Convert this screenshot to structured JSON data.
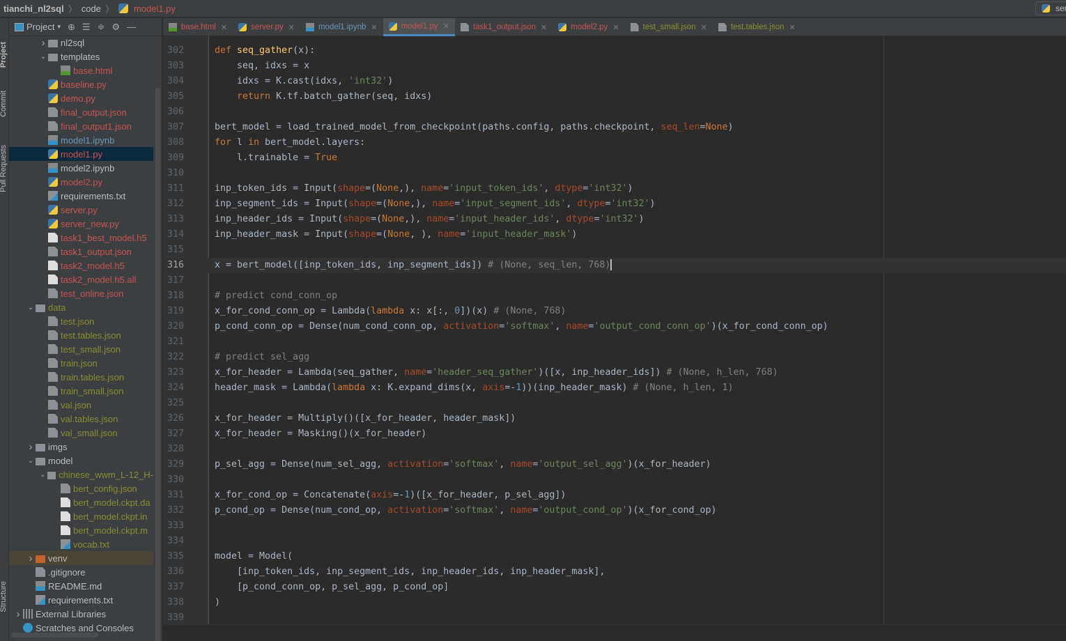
{
  "breadcrumb": [
    "tianchi_nl2sql",
    "code",
    "model1.py"
  ],
  "run_config": "ser",
  "tool_strip": [
    "Project",
    "Commit",
    "Pull Requests",
    "Structure"
  ],
  "project_panel": {
    "title": "Project"
  },
  "colors": {
    "untracked": "#c75450",
    "modified": "#6897bb",
    "ignored": "#8c8c2e",
    "normal": "#bbbbbb",
    "accent": "#4a88c7"
  },
  "tree": [
    {
      "label": "nl2sql",
      "depth": 2,
      "arrow": "right",
      "icon": "folder",
      "color": "normal"
    },
    {
      "label": "templates",
      "depth": 2,
      "arrow": "down",
      "icon": "folder",
      "color": "normal"
    },
    {
      "label": "base.html",
      "depth": 3,
      "icon": "html",
      "color": "untracked"
    },
    {
      "label": "baseline.py",
      "depth": 2,
      "icon": "py",
      "color": "untracked"
    },
    {
      "label": "demo.py",
      "depth": 2,
      "icon": "py",
      "color": "untracked"
    },
    {
      "label": "final_output.json",
      "depth": 2,
      "icon": "json",
      "color": "untracked"
    },
    {
      "label": "final_output1.json",
      "depth": 2,
      "icon": "json",
      "color": "untracked"
    },
    {
      "label": "model1.ipynb",
      "depth": 2,
      "icon": "ipynb",
      "color": "modified"
    },
    {
      "label": "model1.py",
      "depth": 2,
      "icon": "py",
      "color": "untracked",
      "selected": true
    },
    {
      "label": "model2.ipynb",
      "depth": 2,
      "icon": "ipynb",
      "color": "normal"
    },
    {
      "label": "model2.py",
      "depth": 2,
      "icon": "py",
      "color": "untracked"
    },
    {
      "label": "requirements.txt",
      "depth": 2,
      "icon": "txt",
      "color": "normal"
    },
    {
      "label": "server.py",
      "depth": 2,
      "icon": "py",
      "color": "untracked"
    },
    {
      "label": "server_new.py",
      "depth": 2,
      "icon": "py",
      "color": "untracked"
    },
    {
      "label": "task1_best_model.h5",
      "depth": 2,
      "icon": "file",
      "color": "untracked"
    },
    {
      "label": "task1_output.json",
      "depth": 2,
      "icon": "json",
      "color": "untracked"
    },
    {
      "label": "task2_model.h5",
      "depth": 2,
      "icon": "file",
      "color": "untracked"
    },
    {
      "label": "task2_model.h5.all",
      "depth": 2,
      "icon": "file",
      "color": "untracked"
    },
    {
      "label": "test_online.json",
      "depth": 2,
      "icon": "json",
      "color": "untracked"
    },
    {
      "label": "data",
      "depth": 1,
      "arrow": "down",
      "icon": "folder",
      "color": "ignored"
    },
    {
      "label": "test.json",
      "depth": 2,
      "icon": "json",
      "color": "ignored"
    },
    {
      "label": "test.tables.json",
      "depth": 2,
      "icon": "json",
      "color": "ignored"
    },
    {
      "label": "test_small.json",
      "depth": 2,
      "icon": "json",
      "color": "ignored"
    },
    {
      "label": "train.json",
      "depth": 2,
      "icon": "json",
      "color": "ignored"
    },
    {
      "label": "train.tables.json",
      "depth": 2,
      "icon": "json",
      "color": "ignored"
    },
    {
      "label": "train_small.json",
      "depth": 2,
      "icon": "json",
      "color": "ignored"
    },
    {
      "label": "val.json",
      "depth": 2,
      "icon": "json",
      "color": "ignored"
    },
    {
      "label": "val.tables.json",
      "depth": 2,
      "icon": "json",
      "color": "ignored"
    },
    {
      "label": "val_small.json",
      "depth": 2,
      "icon": "json",
      "color": "ignored"
    },
    {
      "label": "imgs",
      "depth": 1,
      "arrow": "right",
      "icon": "folder",
      "color": "normal"
    },
    {
      "label": "model",
      "depth": 1,
      "arrow": "down",
      "icon": "folder",
      "color": "normal"
    },
    {
      "label": "chinese_wwm_L-12_H-",
      "depth": 2,
      "arrow": "down",
      "icon": "folder",
      "color": "ignored"
    },
    {
      "label": "bert_config.json",
      "depth": 3,
      "icon": "json",
      "color": "ignored"
    },
    {
      "label": "bert_model.ckpt.da",
      "depth": 3,
      "icon": "file",
      "color": "ignored"
    },
    {
      "label": "bert_model.ckpt.in",
      "depth": 3,
      "icon": "file",
      "color": "ignored"
    },
    {
      "label": "bert_model.ckpt.m",
      "depth": 3,
      "icon": "file",
      "color": "ignored"
    },
    {
      "label": "vocab.txt",
      "depth": 3,
      "icon": "txt",
      "color": "ignored"
    },
    {
      "label": "venv",
      "depth": 1,
      "arrow": "right",
      "icon": "folder-orange",
      "color": "normal",
      "venv": true
    },
    {
      "label": ".gitignore",
      "depth": 1,
      "icon": "json",
      "color": "normal"
    },
    {
      "label": "README.md",
      "depth": 1,
      "icon": "md",
      "color": "normal"
    },
    {
      "label": "requirements.txt",
      "depth": 1,
      "icon": "txt",
      "color": "normal"
    },
    {
      "label": "External Libraries",
      "depth": 0,
      "arrow": "right",
      "icon": "libs",
      "color": "normal"
    },
    {
      "label": "Scratches and Consoles",
      "depth": 0,
      "icon": "scratch",
      "color": "normal"
    }
  ],
  "tabs": [
    {
      "label": "base.html",
      "icon": "html",
      "color": "untracked"
    },
    {
      "label": "server.py",
      "icon": "py",
      "color": "untracked"
    },
    {
      "label": "model1.ipynb",
      "icon": "ipynb",
      "color": "modified"
    },
    {
      "label": "model1.py",
      "icon": "py",
      "color": "untracked",
      "active": true
    },
    {
      "label": "task1_output.json",
      "icon": "json",
      "color": "untracked"
    },
    {
      "label": "model2.py",
      "icon": "py",
      "color": "untracked"
    },
    {
      "label": "test_small.json",
      "icon": "json",
      "color": "ignored"
    },
    {
      "label": "test.tables.json",
      "icon": "json",
      "color": "ignored"
    }
  ],
  "editor": {
    "current_line": 316,
    "lines": [
      {
        "n": 302,
        "t": [
          [
            "k",
            "def "
          ],
          [
            "f",
            "seq_gather"
          ],
          [
            "t",
            "(x):"
          ]
        ]
      },
      {
        "n": 303,
        "t": [
          [
            "t",
            "    seq, idxs = x"
          ]
        ]
      },
      {
        "n": 304,
        "t": [
          [
            "t",
            "    idxs = K.cast(idxs, "
          ],
          [
            "s",
            "'int32'"
          ],
          [
            "t",
            ")"
          ]
        ]
      },
      {
        "n": 305,
        "t": [
          [
            "t",
            "    "
          ],
          [
            "k",
            "return"
          ],
          [
            "t",
            " K.tf.batch_gather(seq, idxs)"
          ]
        ]
      },
      {
        "n": 306,
        "t": []
      },
      {
        "n": 307,
        "t": [
          [
            "t",
            "bert_model = load_trained_model_from_checkpoint(paths.config, paths.checkpoint, "
          ],
          [
            "p",
            "seq_len"
          ],
          [
            "t",
            "="
          ],
          [
            "k",
            "None"
          ],
          [
            "t",
            ")"
          ]
        ]
      },
      {
        "n": 308,
        "t": [
          [
            "k",
            "for"
          ],
          [
            "t",
            " l "
          ],
          [
            "k",
            "in"
          ],
          [
            "t",
            " bert_model.layers:"
          ]
        ]
      },
      {
        "n": 309,
        "t": [
          [
            "t",
            "    l.trainable = "
          ],
          [
            "k",
            "True"
          ]
        ]
      },
      {
        "n": 310,
        "t": []
      },
      {
        "n": 311,
        "t": [
          [
            "t",
            "inp_token_ids = Input("
          ],
          [
            "p",
            "shape"
          ],
          [
            "t",
            "=("
          ],
          [
            "k",
            "None"
          ],
          [
            "t",
            ",), "
          ],
          [
            "p",
            "name"
          ],
          [
            "t",
            "="
          ],
          [
            "s",
            "'input_token_ids'"
          ],
          [
            "t",
            ", "
          ],
          [
            "p",
            "dtype"
          ],
          [
            "t",
            "="
          ],
          [
            "s",
            "'int32'"
          ],
          [
            "t",
            ")"
          ]
        ]
      },
      {
        "n": 312,
        "t": [
          [
            "t",
            "inp_segment_ids = Input("
          ],
          [
            "p",
            "shape"
          ],
          [
            "t",
            "=("
          ],
          [
            "k",
            "None"
          ],
          [
            "t",
            ",), "
          ],
          [
            "p",
            "name"
          ],
          [
            "t",
            "="
          ],
          [
            "s",
            "'input_segment_ids'"
          ],
          [
            "t",
            ", "
          ],
          [
            "p",
            "dtype"
          ],
          [
            "t",
            "="
          ],
          [
            "s",
            "'int32'"
          ],
          [
            "t",
            ")"
          ]
        ]
      },
      {
        "n": 313,
        "t": [
          [
            "t",
            "inp_header_ids = Input("
          ],
          [
            "p",
            "shape"
          ],
          [
            "t",
            "=("
          ],
          [
            "k",
            "None"
          ],
          [
            "t",
            ",), "
          ],
          [
            "p",
            "name"
          ],
          [
            "t",
            "="
          ],
          [
            "s",
            "'input_header_ids'"
          ],
          [
            "t",
            ", "
          ],
          [
            "p",
            "dtype"
          ],
          [
            "t",
            "="
          ],
          [
            "s",
            "'int32'"
          ],
          [
            "t",
            ")"
          ]
        ]
      },
      {
        "n": 314,
        "t": [
          [
            "t",
            "inp_header_mask = Input("
          ],
          [
            "p",
            "shape"
          ],
          [
            "t",
            "=("
          ],
          [
            "k",
            "None"
          ],
          [
            "t",
            ", ), "
          ],
          [
            "p",
            "name"
          ],
          [
            "t",
            "="
          ],
          [
            "s",
            "'input_header_mask'"
          ],
          [
            "t",
            ")"
          ]
        ]
      },
      {
        "n": 315,
        "t": []
      },
      {
        "n": 316,
        "t": [
          [
            "t",
            "x = bert_model([inp_token_ids, inp_segment_ids]) "
          ],
          [
            "c",
            "# (None, seq_len, 768)"
          ]
        ]
      },
      {
        "n": 317,
        "t": []
      },
      {
        "n": 318,
        "t": [
          [
            "c",
            "# predict cond_conn_op"
          ]
        ]
      },
      {
        "n": 319,
        "t": [
          [
            "t",
            "x_for_cond_conn_op = Lambda("
          ],
          [
            "k",
            "lambda"
          ],
          [
            "t",
            " x: x[:, "
          ],
          [
            "n",
            "0"
          ],
          [
            "t",
            "])(x) "
          ],
          [
            "c",
            "# (None, 768)"
          ]
        ]
      },
      {
        "n": 320,
        "t": [
          [
            "t",
            "p_cond_conn_op = Dense(num_cond_conn_op, "
          ],
          [
            "p",
            "activation"
          ],
          [
            "t",
            "="
          ],
          [
            "s",
            "'softmax'"
          ],
          [
            "t",
            ", "
          ],
          [
            "p",
            "name"
          ],
          [
            "t",
            "="
          ],
          [
            "s",
            "'output_cond_conn_op'"
          ],
          [
            "t",
            ")(x_for_cond_conn_op)"
          ]
        ]
      },
      {
        "n": 321,
        "t": []
      },
      {
        "n": 322,
        "t": [
          [
            "c",
            "# predict sel_agg"
          ]
        ]
      },
      {
        "n": 323,
        "t": [
          [
            "t",
            "x_for_header = Lambda(seq_gather, "
          ],
          [
            "p",
            "name"
          ],
          [
            "t",
            "="
          ],
          [
            "s",
            "'header_seq_gather'"
          ],
          [
            "t",
            ")([x, inp_header_ids]) "
          ],
          [
            "c",
            "# (None, h_len, 768)"
          ]
        ]
      },
      {
        "n": 324,
        "t": [
          [
            "t",
            "header_mask = Lambda("
          ],
          [
            "k",
            "lambda"
          ],
          [
            "t",
            " x: K.expand_dims(x, "
          ],
          [
            "p",
            "axis"
          ],
          [
            "t",
            "=-"
          ],
          [
            "n",
            "1"
          ],
          [
            "t",
            "))(inp_header_mask) "
          ],
          [
            "c",
            "# (None, h_len, 1)"
          ]
        ]
      },
      {
        "n": 325,
        "t": []
      },
      {
        "n": 326,
        "t": [
          [
            "t",
            "x_for_header = Multiply()([x_for_header, header_mask])"
          ]
        ]
      },
      {
        "n": 327,
        "t": [
          [
            "t",
            "x_for_header = Masking()(x_for_header)"
          ]
        ]
      },
      {
        "n": 328,
        "t": []
      },
      {
        "n": 329,
        "t": [
          [
            "t",
            "p_sel_agg = Dense(num_sel_agg, "
          ],
          [
            "p",
            "activation"
          ],
          [
            "t",
            "="
          ],
          [
            "s",
            "'softmax'"
          ],
          [
            "t",
            ", "
          ],
          [
            "p",
            "name"
          ],
          [
            "t",
            "="
          ],
          [
            "s",
            "'output_sel_agg'"
          ],
          [
            "t",
            ")(x_for_header)"
          ]
        ]
      },
      {
        "n": 330,
        "t": []
      },
      {
        "n": 331,
        "t": [
          [
            "t",
            "x_for_cond_op = Concatenate("
          ],
          [
            "p",
            "axis"
          ],
          [
            "t",
            "=-"
          ],
          [
            "n",
            "1"
          ],
          [
            "t",
            ")([x_for_header, p_sel_agg])"
          ]
        ]
      },
      {
        "n": 332,
        "t": [
          [
            "t",
            "p_cond_op = Dense(num_cond_op, "
          ],
          [
            "p",
            "activation"
          ],
          [
            "t",
            "="
          ],
          [
            "s",
            "'softmax'"
          ],
          [
            "t",
            ", "
          ],
          [
            "p",
            "name"
          ],
          [
            "t",
            "="
          ],
          [
            "s",
            "'output_cond_op'"
          ],
          [
            "t",
            ")(x_for_cond_op)"
          ]
        ]
      },
      {
        "n": 333,
        "t": []
      },
      {
        "n": 334,
        "t": []
      },
      {
        "n": 335,
        "t": [
          [
            "t",
            "model = Model("
          ]
        ]
      },
      {
        "n": 336,
        "t": [
          [
            "t",
            "    [inp_token_ids, inp_segment_ids, inp_header_ids, inp_header_mask],"
          ]
        ]
      },
      {
        "n": 337,
        "t": [
          [
            "t",
            "    [p_cond_conn_op, p_sel_agg, p_cond_op]"
          ]
        ]
      },
      {
        "n": 338,
        "t": [
          [
            "t",
            ")"
          ]
        ]
      },
      {
        "n": 339,
        "t": []
      }
    ]
  }
}
